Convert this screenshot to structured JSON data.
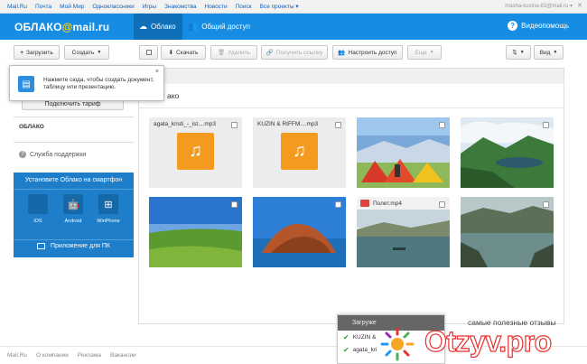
{
  "topnav": {
    "links": [
      "Mail.Ru",
      "Почта",
      "Мой Мир",
      "Одноклассники",
      "Игры",
      "Знакомства",
      "Новости",
      "Поиск",
      "Все проекты ▾"
    ],
    "user": "masha-kusina-83@mail.ru ▾",
    "close": "✕"
  },
  "header": {
    "logo_text": "ОБЛАКО",
    "logo_at": "@",
    "logo_domain": "mail.ru",
    "tab_cloud": "Облако",
    "tab_shared": "Общий доступ",
    "help_label": "Видеопомощь"
  },
  "toolbar": {
    "upload": "Загрузить",
    "create": "Создать",
    "download": "Скачать",
    "delete": "Удалить",
    "get_link": "Получить ссылку",
    "access": "Настроить доступ",
    "more": "Еще",
    "view": "Вид"
  },
  "tooltip": {
    "text": "Нажмите сюда, чтобы создать документ, таблицу или презентацию.",
    "close": "×"
  },
  "sidebar": {
    "tariff_button": "Подключить тариф",
    "section_title": "ОБЛАКО",
    "support": "Служба поддержки",
    "mobile_title": "Установите Облако на смартфон",
    "os": [
      {
        "label": "iOS"
      },
      {
        "label": "Android"
      },
      {
        "label": "WinPhone"
      }
    ],
    "pc_label": "Приложение для ПК"
  },
  "main": {
    "breadcrumb": "ако",
    "tiles": [
      {
        "kind": "audio",
        "name": "agata_kristi_-_ist....mp3"
      },
      {
        "kind": "audio",
        "name": "KUZIN & RIFFM....mp3"
      },
      {
        "kind": "photo",
        "name": ""
      },
      {
        "kind": "photo",
        "name": ""
      },
      {
        "kind": "photo",
        "name": ""
      },
      {
        "kind": "photo",
        "name": ""
      },
      {
        "kind": "video",
        "name": "Полет.mp4"
      },
      {
        "kind": "photo",
        "name": ""
      }
    ]
  },
  "uploads": {
    "header": "Загруже",
    "items": [
      "KUZIN &",
      "agata_kri"
    ]
  },
  "footer": {
    "links": [
      "Mail.Ru",
      "О компании",
      "Реклама",
      "Вакансии"
    ]
  },
  "watermark": {
    "tagline": "самые полезные отзывы",
    "brand": "Otzyv.pro"
  }
}
